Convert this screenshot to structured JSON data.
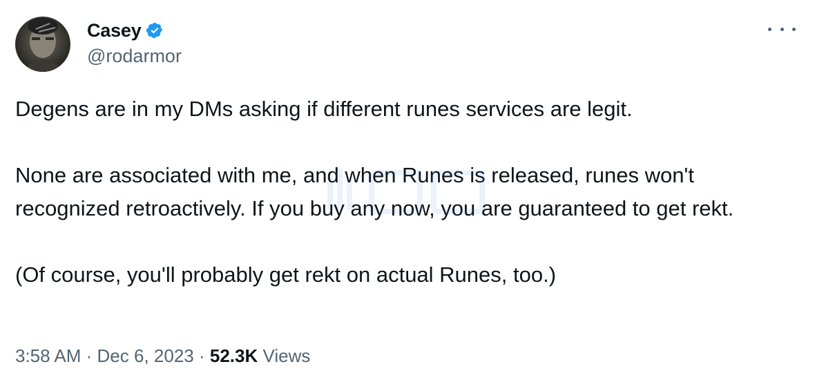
{
  "author": {
    "display_name": "Casey",
    "handle": "@rodarmor",
    "verified": true,
    "verified_color": "#1d9bf0"
  },
  "tweet": {
    "paragraphs": [
      "Degens are in my DMs asking if different runes services are legit.",
      "None are associated with me, and when Runes is released, runes won't recognized retroactively. If you buy any now, you are guaranteed to get rekt.",
      "(Of course, you'll probably get rekt on actual Runes, too.)"
    ],
    "time": "3:58 AM",
    "date": "Dec 6, 2023",
    "separator": "·",
    "views_count": "52.3K",
    "views_label": "Views"
  },
  "icons": {
    "more": "more-horizontal-icon",
    "verified": "verified-badge-icon"
  },
  "colors": {
    "text_primary": "#0f1419",
    "text_secondary": "#536471",
    "accent": "#1d9bf0"
  }
}
